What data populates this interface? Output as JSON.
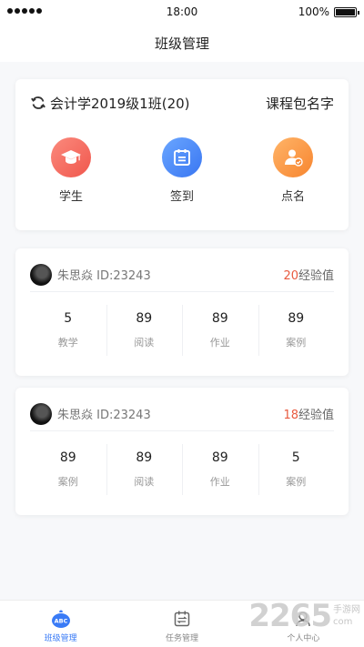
{
  "status_bar": {
    "time": "18:00",
    "battery": "100%"
  },
  "nav": {
    "title": "班级管理"
  },
  "class_card": {
    "class_name": "会计学2019级1班(20)",
    "package_name": "课程包名字",
    "actions": [
      {
        "label": "学生",
        "icon": "graduation-cap-icon",
        "color": "#f0574d"
      },
      {
        "label": "签到",
        "icon": "calendar-checkin-icon",
        "color": "#3976f2"
      },
      {
        "label": "点名",
        "icon": "user-check-icon",
        "color": "#f7852f"
      }
    ]
  },
  "students": [
    {
      "name": "朱思焱 ID:23243",
      "exp_value": "20",
      "exp_label": "经验值",
      "stats": [
        {
          "value": "5",
          "label": "教学"
        },
        {
          "value": "89",
          "label": "阅读"
        },
        {
          "value": "89",
          "label": "作业"
        },
        {
          "value": "89",
          "label": "案例"
        }
      ]
    },
    {
      "name": "朱思焱 ID:23243",
      "exp_value": "18",
      "exp_label": "经验值",
      "stats": [
        {
          "value": "89",
          "label": "案例"
        },
        {
          "value": "89",
          "label": "阅读"
        },
        {
          "value": "89",
          "label": "作业"
        },
        {
          "value": "5",
          "label": "案例"
        }
      ]
    }
  ],
  "tabbar": {
    "items": [
      {
        "label": "班级管理",
        "icon": "abc-class-icon",
        "active": true
      },
      {
        "label": "任务管理",
        "icon": "task-calendar-icon",
        "active": false
      },
      {
        "label": "个人中心",
        "icon": "person-icon",
        "active": false
      }
    ]
  },
  "watermark": {
    "logo": "2265",
    "line1": "手游网",
    "line2": "com"
  },
  "colors": {
    "accent": "#3a7bf6",
    "exp": "#e85a3f"
  }
}
